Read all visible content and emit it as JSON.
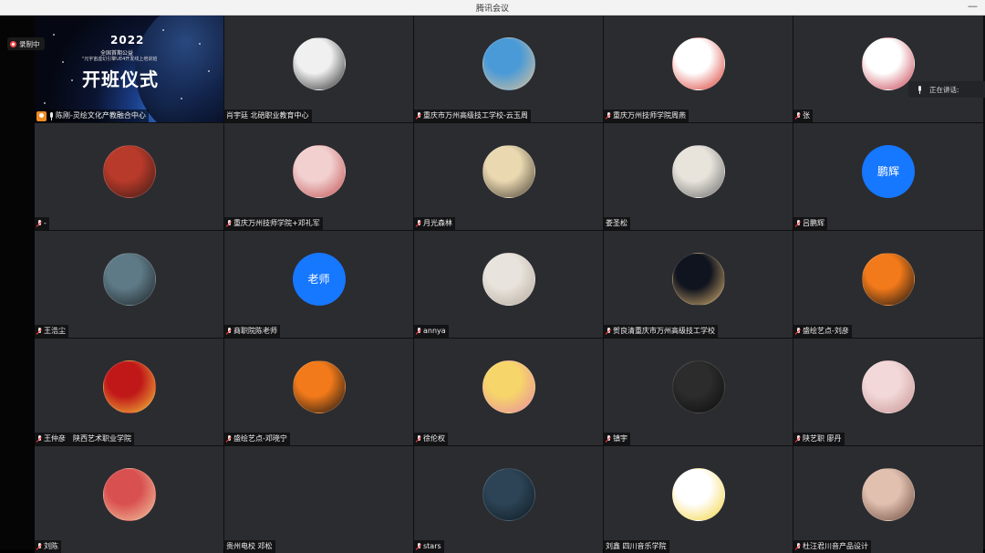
{
  "window": {
    "title": "腾讯会议",
    "minimize_glyph": "—"
  },
  "recording": {
    "label": "录制中",
    "icon": "cloud-record-icon"
  },
  "speaking": {
    "label": "正在讲话:",
    "icon": "microphone-icon"
  },
  "shared_screen": {
    "year": "2022",
    "line1": "全国首期公益",
    "line2": "\"元宇宙虚幻引擎UE4开发线上培训班",
    "headline": "开班仪式"
  },
  "participants": [
    {
      "name": "陈刚-灵绘文化产教融合中心",
      "mic": "plain",
      "host": true,
      "avatar": "shared-screen"
    },
    {
      "name": "肖宇廷 北碚职业教育中心",
      "mic": "none",
      "avatar": "photo",
      "colors": [
        "#f0f0f0",
        "#2a2a2a"
      ]
    },
    {
      "name": "重庆市万州高级技工学校-云玉周",
      "mic": "muted",
      "avatar": "photo",
      "colors": [
        "#4a9ad8",
        "#d9c29a"
      ]
    },
    {
      "name": "重庆万州技师学院周燕",
      "mic": "muted",
      "avatar": "photo",
      "colors": [
        "#ffffff",
        "#d9342b"
      ]
    },
    {
      "name": "张",
      "mic": "muted",
      "avatar": "photo",
      "colors": [
        "#ffffff",
        "#c43b4a"
      ]
    },
    {
      "name": "-",
      "mic": "muted",
      "avatar": "photo",
      "colors": [
        "#b83a2a",
        "#3a1a14"
      ]
    },
    {
      "name": "重庆万州技师学院+邓礼军",
      "mic": "muted",
      "avatar": "photo",
      "colors": [
        "#f2d0d0",
        "#c05050"
      ]
    },
    {
      "name": "月光森林",
      "mic": "muted",
      "avatar": "photo",
      "colors": [
        "#e9d8b0",
        "#4a4034"
      ]
    },
    {
      "name": "娄圣松",
      "mic": "none",
      "avatar": "photo",
      "colors": [
        "#e8e4dc",
        "#6a6a6a"
      ]
    },
    {
      "name": "吕鹏辉",
      "mic": "muted",
      "avatar": "text",
      "text": "鹏辉",
      "colors": [
        "#1677ff",
        "#1677ff"
      ]
    },
    {
      "name": "王浩尘",
      "mic": "muted",
      "avatar": "photo",
      "colors": [
        "#5e7a86",
        "#1c2226"
      ]
    },
    {
      "name": "商职院陈老师",
      "mic": "muted",
      "avatar": "text",
      "text": "老师",
      "colors": [
        "#1677ff",
        "#1677ff"
      ]
    },
    {
      "name": "annya",
      "mic": "muted",
      "avatar": "photo",
      "colors": [
        "#e8e3dc",
        "#b4aa9c"
      ]
    },
    {
      "name": "贺良清重庆市万州高级技工学校",
      "mic": "muted",
      "avatar": "photo",
      "colors": [
        "#10141e",
        "#d8b070"
      ]
    },
    {
      "name": "盛绘艺点-刘彦",
      "mic": "muted",
      "avatar": "photo",
      "colors": [
        "#f27a1a",
        "#111111"
      ]
    },
    {
      "name": "王仲彦　陕西艺术职业学院",
      "mic": "muted",
      "avatar": "photo",
      "colors": [
        "#c01818",
        "#f2c23a"
      ]
    },
    {
      "name": "盛绘艺点-邓晓宁",
      "mic": "muted",
      "avatar": "photo",
      "colors": [
        "#f27a1a",
        "#111111"
      ]
    },
    {
      "name": "徐伦权",
      "mic": "muted",
      "avatar": "photo",
      "colors": [
        "#f6d56a",
        "#e88aa0"
      ]
    },
    {
      "name": "镇宇",
      "mic": "muted",
      "avatar": "photo",
      "colors": [
        "#2c2c2c",
        "#0b0b0b"
      ]
    },
    {
      "name": "陕艺职 廖丹",
      "mic": "muted",
      "avatar": "photo",
      "colors": [
        "#f2d8d8",
        "#c89494"
      ]
    },
    {
      "name": "刘陈",
      "mic": "muted",
      "avatar": "photo",
      "colors": [
        "#d85050",
        "#f2c8a0"
      ]
    },
    {
      "name": "贵州电校 邓松",
      "mic": "none",
      "avatar": "none"
    },
    {
      "name": "stars",
      "mic": "muted",
      "avatar": "photo",
      "colors": [
        "#2c4456",
        "#0e1a22"
      ]
    },
    {
      "name": "刘鑫 四川音乐学院",
      "mic": "none",
      "avatar": "photo",
      "colors": [
        "#ffffff",
        "#f2d23a"
      ]
    },
    {
      "name": "杜汪君川音产品设计",
      "mic": "muted",
      "avatar": "photo",
      "colors": [
        "#e2c0b0",
        "#6a4a3c"
      ]
    }
  ]
}
